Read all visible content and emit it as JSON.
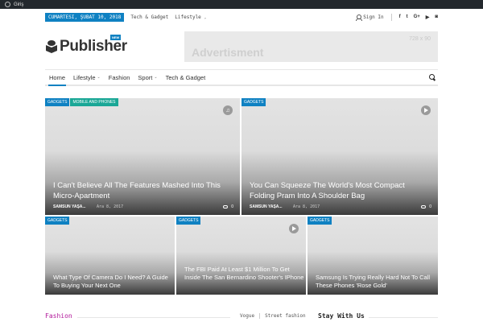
{
  "adminbar": {
    "login_label": "Giriş"
  },
  "topbar": {
    "date": "CUMARTESI, ŞUBAT 10, 2018",
    "links": [
      {
        "label": "Tech & Gadget",
        "has_dropdown": false
      },
      {
        "label": "Lifestyle",
        "has_dropdown": true
      }
    ],
    "signin_label": "Sign In",
    "social": [
      "f",
      "t",
      "G+",
      "yt",
      "ig"
    ]
  },
  "header": {
    "logo_text": "Publisher",
    "logo_badge": "NEW",
    "ad_text": "Advertisment",
    "ad_size": "728 x 90"
  },
  "nav": {
    "items": [
      {
        "label": "Home",
        "active": true,
        "has_dropdown": false
      },
      {
        "label": "Lifestyle",
        "active": false,
        "has_dropdown": true
      },
      {
        "label": "Fashion",
        "active": false,
        "has_dropdown": false
      },
      {
        "label": "Sport",
        "active": false,
        "has_dropdown": true
      },
      {
        "label": "Tech & Gadget",
        "active": false,
        "has_dropdown": false
      }
    ]
  },
  "posts": [
    {
      "badges": [
        "GADGETS",
        "MOBILE AND PHONES"
      ],
      "title": "I Can't Believe All The Features Mashed Into This Micro-Apartment",
      "author": "SAMSUN YAŞA...",
      "date": "Ara 8, 2017",
      "comments": "0",
      "format": "audio"
    },
    {
      "badges": [
        "GADGETS"
      ],
      "title": "You Can Squeeze The World's Most Compact Folding Pram Into A Shoulder Bag",
      "author": "SAMSUN YAŞA...",
      "date": "Ara 8, 2017",
      "comments": "0",
      "format": "video"
    },
    {
      "badges": [
        "GADGETS"
      ],
      "title": "What Type Of Camera Do I Need? A Guide To Buying Your Next One",
      "format": ""
    },
    {
      "badges": [
        "GADGETS"
      ],
      "title": "The FBI Paid At Least $1 Million To Get Inside The San Bernardino Shooter's IPhone",
      "format": "video"
    },
    {
      "badges": [
        "GADGETS"
      ],
      "title": "Samsung Is Trying Really Hard Not To Call These Phones 'Rose Gold'",
      "format": ""
    }
  ],
  "fashion_section": {
    "title": "Fashion",
    "tabs": [
      "Vogue",
      "Street fashion"
    ]
  },
  "sidebar": {
    "stay_title": "Stay With Us"
  },
  "colors": {
    "accent": "#0f81c2",
    "teal": "#1aa796",
    "fashion": "#b1189a",
    "adminbar": "#23282d"
  }
}
